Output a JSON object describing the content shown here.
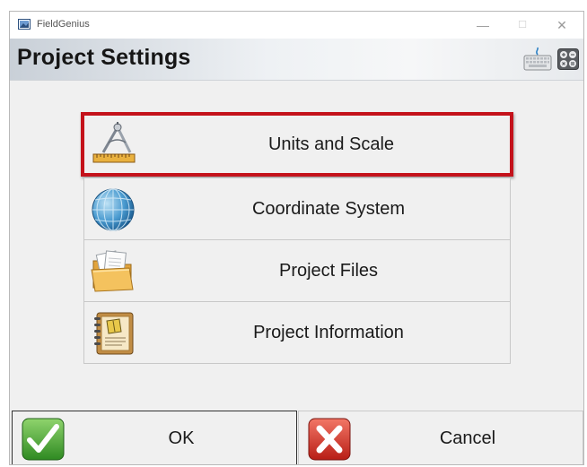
{
  "window": {
    "app_title": "FieldGenius",
    "controls": {
      "minimize": "—",
      "maximize": "☐",
      "close": "✕"
    }
  },
  "header": {
    "title": "Project Settings",
    "icons": [
      "keyboard-icon",
      "calculator-icon"
    ]
  },
  "menu": {
    "items": [
      {
        "label": "Units and Scale",
        "icon": "drafting-compass-ruler-icon",
        "selected": true
      },
      {
        "label": "Coordinate System",
        "icon": "globe-icon",
        "selected": false
      },
      {
        "label": "Project Files",
        "icon": "folder-documents-icon",
        "selected": false
      },
      {
        "label": "Project Information",
        "icon": "notebook-icon",
        "selected": false
      }
    ]
  },
  "buttons": {
    "ok": {
      "label": "OK",
      "icon": "green-checkmark-icon"
    },
    "cancel": {
      "label": "Cancel",
      "icon": "red-x-icon"
    }
  },
  "colors": {
    "selection_outline": "#c4121b",
    "ok_green": "#3f9b2c",
    "cancel_red": "#d8322a"
  }
}
